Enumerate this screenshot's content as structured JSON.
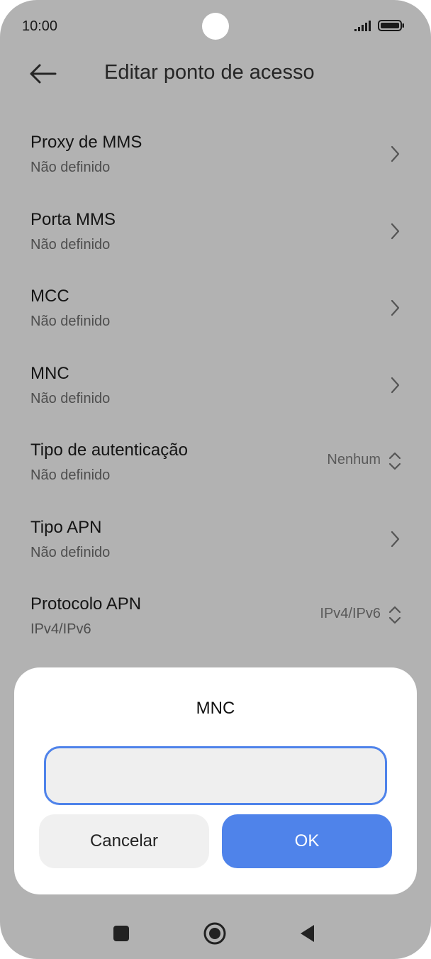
{
  "status_bar": {
    "time": "10:00",
    "icons": [
      "signal-icon",
      "battery-icon"
    ]
  },
  "app_bar": {
    "back_icon": "arrow-left-icon",
    "title": "Editar ponto de acesso"
  },
  "settings": [
    {
      "title": "Proxy de MMS",
      "subtitle": "Não definido",
      "value": "",
      "control": "chevron-right-icon"
    },
    {
      "title": "Porta MMS",
      "subtitle": "Não definido",
      "value": "",
      "control": "chevron-right-icon"
    },
    {
      "title": "MCC",
      "subtitle": "Não definido",
      "value": "",
      "control": "chevron-right-icon"
    },
    {
      "title": "MNC",
      "subtitle": "Não definido",
      "value": "",
      "control": "chevron-right-icon"
    },
    {
      "title": "Tipo de autenticação",
      "subtitle": "Não definido",
      "value": "Nenhum",
      "control": "up-down-icon"
    },
    {
      "title": "Tipo APN",
      "subtitle": "Não definido",
      "value": "",
      "control": "chevron-right-icon"
    },
    {
      "title": "Protocolo APN",
      "subtitle": "IPv4/IPv6",
      "value": "IPv4/IPv6",
      "control": "up-down-icon"
    }
  ],
  "dialog": {
    "title": "MNC",
    "input_value": "",
    "cancel_label": "Cancelar",
    "ok_label": "OK"
  },
  "nav_bar": {
    "icons": [
      "recent-apps-icon",
      "home-icon",
      "back-triangle-icon"
    ]
  },
  "colors": {
    "accent": "#4f83ea",
    "overlay": "#b2b2b2",
    "dialog_bg": "#ffffff"
  }
}
